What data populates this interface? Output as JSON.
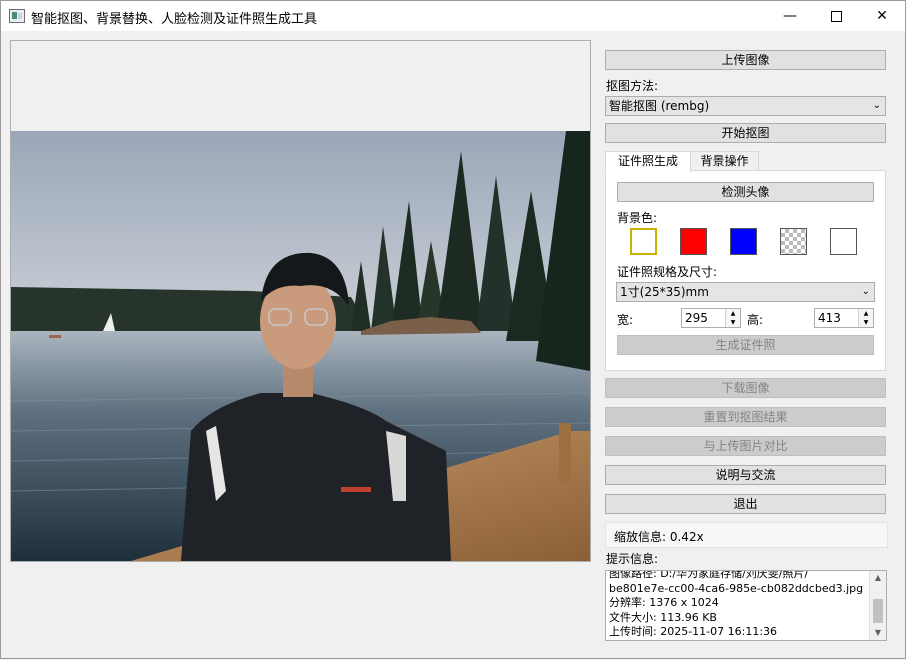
{
  "window": {
    "title": "智能抠图、背景替换、人脸检测及证件照生成工具",
    "minimize_glyph": "—",
    "close_glyph": "✕"
  },
  "controls": {
    "upload_button": "上传图像",
    "matting_method_label": "抠图方法:",
    "matting_method_value": "智能抠图 (rembg)",
    "start_matting_button": "开始抠图"
  },
  "tabs": [
    {
      "label": "证件照生成",
      "active": true
    },
    {
      "label": "背景操作",
      "active": false
    }
  ],
  "id_photo": {
    "detect_face_button": "检测头像",
    "bg_color_label": "背景色:",
    "swatches": [
      {
        "name": "yellow-outline",
        "fill": "#ffffff",
        "border": "#c8b400"
      },
      {
        "name": "red",
        "fill": "#ff0000",
        "border": "#555555"
      },
      {
        "name": "blue",
        "fill": "#0000ff",
        "border": "#555555"
      },
      {
        "name": "transparent",
        "fill": "checker",
        "border": "#555555"
      },
      {
        "name": "white",
        "fill": "#ffffff",
        "border": "#555555"
      }
    ],
    "spec_label": "证件照规格及尺寸:",
    "spec_value": "1寸(25*35)mm",
    "width_label": "宽:",
    "width_value": "295",
    "height_label": "高:",
    "height_value": "413",
    "generate_button": "生成证件照"
  },
  "actions": {
    "download_button": "下载图像",
    "reset_button": "重置到抠图结果",
    "compare_button": "与上传图片对比",
    "help_button": "说明与交流",
    "exit_button": "退出"
  },
  "zoom_info": "缩放信息: 0.42x",
  "info_label": "提示信息:",
  "info_lines": [
    "图像路径: D:/华为家庭存储/刘庆雯/照片/",
    "be801e7e-cc00-4ca6-985e-cb082ddcbed3.jpg",
    "分辨率: 1376 x 1024",
    "文件大小: 113.96 KB",
    "上传时间: 2025-11-07 16:11:36"
  ]
}
